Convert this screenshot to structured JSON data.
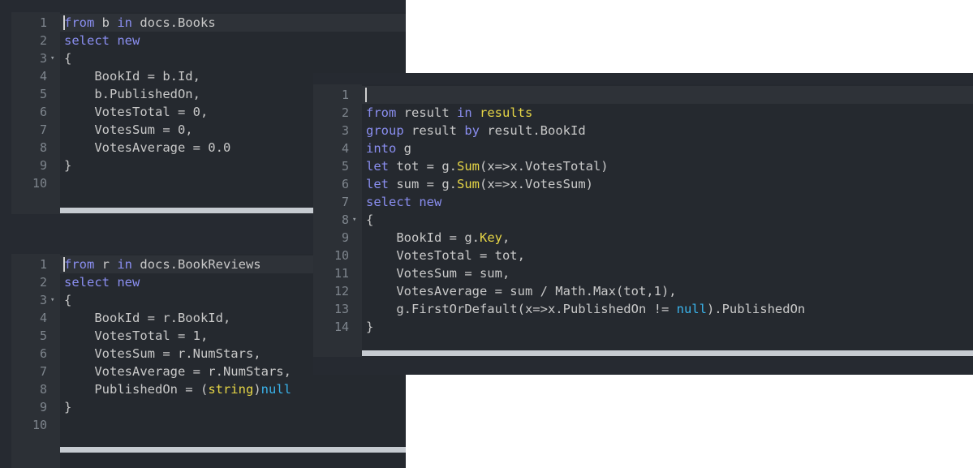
{
  "editors": [
    {
      "id": "map-books",
      "lines": [
        [
          [
            "kw",
            "from"
          ],
          [
            "t",
            " b "
          ],
          [
            "kw",
            "in"
          ],
          [
            "t",
            " docs.Books"
          ]
        ],
        [
          [
            "kw",
            "select"
          ],
          [
            "t",
            " "
          ],
          [
            "kw",
            "new"
          ]
        ],
        [
          [
            "t",
            "{"
          ]
        ],
        [
          [
            "t",
            "    BookId = b.Id,"
          ]
        ],
        [
          [
            "t",
            "    b.PublishedOn,"
          ]
        ],
        [
          [
            "t",
            "    VotesTotal = 0,"
          ]
        ],
        [
          [
            "t",
            "    VotesSum = 0,"
          ]
        ],
        [
          [
            "t",
            "    VotesAverage = 0.0"
          ]
        ],
        [
          [
            "t",
            "}"
          ]
        ],
        [
          [
            "t",
            ""
          ]
        ]
      ]
    },
    {
      "id": "map-book-reviews",
      "lines": [
        [
          [
            "kw",
            "from"
          ],
          [
            "t",
            " r "
          ],
          [
            "kw",
            "in"
          ],
          [
            "t",
            " docs.BookReviews"
          ]
        ],
        [
          [
            "kw",
            "select"
          ],
          [
            "t",
            " "
          ],
          [
            "kw",
            "new"
          ]
        ],
        [
          [
            "t",
            "{"
          ]
        ],
        [
          [
            "t",
            "    BookId = r.BookId,"
          ]
        ],
        [
          [
            "t",
            "    VotesTotal = 1,"
          ]
        ],
        [
          [
            "t",
            "    VotesSum = r.NumStars,"
          ]
        ],
        [
          [
            "t",
            "    VotesAverage = r.NumStars,"
          ]
        ],
        [
          [
            "t",
            "    PublishedOn = ("
          ],
          [
            "fn",
            "string"
          ],
          [
            "t",
            ")"
          ],
          [
            "nl",
            "null"
          ]
        ],
        [
          [
            "t",
            "}"
          ]
        ],
        [
          [
            "t",
            ""
          ]
        ]
      ]
    },
    {
      "id": "reduce",
      "lines": [
        [
          [
            "t",
            ""
          ]
        ],
        [
          [
            "kw",
            "from"
          ],
          [
            "t",
            " result "
          ],
          [
            "kw",
            "in"
          ],
          [
            "t",
            " "
          ],
          [
            "fn",
            "results"
          ]
        ],
        [
          [
            "kw",
            "group"
          ],
          [
            "t",
            " result "
          ],
          [
            "kw",
            "by"
          ],
          [
            "t",
            " result.BookId"
          ]
        ],
        [
          [
            "kw",
            "into"
          ],
          [
            "t",
            " g"
          ]
        ],
        [
          [
            "kw",
            "let"
          ],
          [
            "t",
            " tot = g."
          ],
          [
            "fn",
            "Sum"
          ],
          [
            "t",
            "(x=>x.VotesTotal)"
          ]
        ],
        [
          [
            "kw",
            "let"
          ],
          [
            "t",
            " sum = g."
          ],
          [
            "fn",
            "Sum"
          ],
          [
            "t",
            "(x=>x.VotesSum)"
          ]
        ],
        [
          [
            "kw",
            "select"
          ],
          [
            "t",
            " "
          ],
          [
            "kw",
            "new"
          ]
        ],
        [
          [
            "t",
            "{"
          ]
        ],
        [
          [
            "t",
            "    BookId = g."
          ],
          [
            "fn",
            "Key"
          ],
          [
            "t",
            ","
          ]
        ],
        [
          [
            "t",
            "    VotesTotal = tot,"
          ]
        ],
        [
          [
            "t",
            "    VotesSum = sum,"
          ]
        ],
        [
          [
            "t",
            "    VotesAverage = sum / Math.Max(tot,1),"
          ]
        ],
        [
          [
            "t",
            "    g.FirstOrDefault(x=>x.PublishedOn != "
          ],
          [
            "nl",
            "null"
          ],
          [
            "t",
            ").PublishedOn"
          ]
        ],
        [
          [
            "t",
            "}"
          ]
        ]
      ]
    }
  ],
  "line_numbers": {
    "map-books": [
      "1",
      "2",
      "3",
      "4",
      "5",
      "6",
      "7",
      "8",
      "9",
      "10"
    ],
    "map-book-reviews": [
      "1",
      "2",
      "3",
      "4",
      "5",
      "6",
      "7",
      "8",
      "9",
      "10"
    ],
    "reduce": [
      "1",
      "2",
      "3",
      "4",
      "5",
      "6",
      "7",
      "8",
      "9",
      "10",
      "11",
      "12",
      "13",
      "14"
    ]
  },
  "fold_marker": "▾",
  "colors": {
    "keyword": "#8a8ef0",
    "function": "#e7d646",
    "null_literal": "#3ab4ec",
    "text": "#c9c9c9"
  }
}
